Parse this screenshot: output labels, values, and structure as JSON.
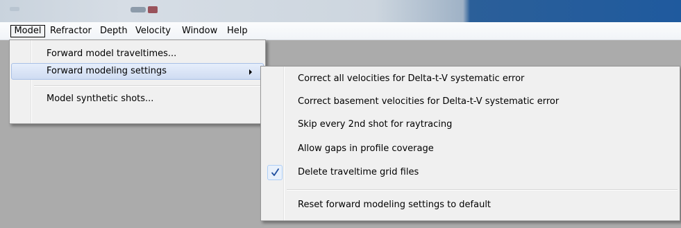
{
  "menubar": {
    "items": [
      "Model",
      "Refractor",
      "Depth",
      "Velocity",
      "Window",
      "Help"
    ]
  },
  "model_menu": {
    "items": [
      {
        "label": "Forward model traveltimes...",
        "has_submenu": false,
        "highlighted": false
      },
      {
        "label": "Forward modeling settings",
        "has_submenu": true,
        "highlighted": true
      },
      {
        "label": "Model synthetic shots...",
        "has_submenu": false,
        "highlighted": false
      }
    ]
  },
  "settings_submenu": {
    "items": [
      {
        "label": "Correct all velocities for Delta-t-V systematic error",
        "checked": false
      },
      {
        "label": "Correct basement velocities for Delta-t-V systematic error",
        "checked": false
      },
      {
        "label": "Skip every 2nd shot for raytracing",
        "checked": false
      },
      {
        "label": "Allow gaps in profile coverage",
        "checked": false
      },
      {
        "label": "Delete traveltime grid files",
        "checked": true
      },
      {
        "label": "Reset forward modeling settings to default",
        "checked": false
      }
    ]
  },
  "colors": {
    "workspace": "#ababab",
    "menu_bg": "#f0f0f0",
    "highlight": "#cfdcf2",
    "check_mark": "#1f4e9e"
  },
  "icons": {
    "submenu_arrow": "chevron-right-icon",
    "check": "check-icon"
  }
}
